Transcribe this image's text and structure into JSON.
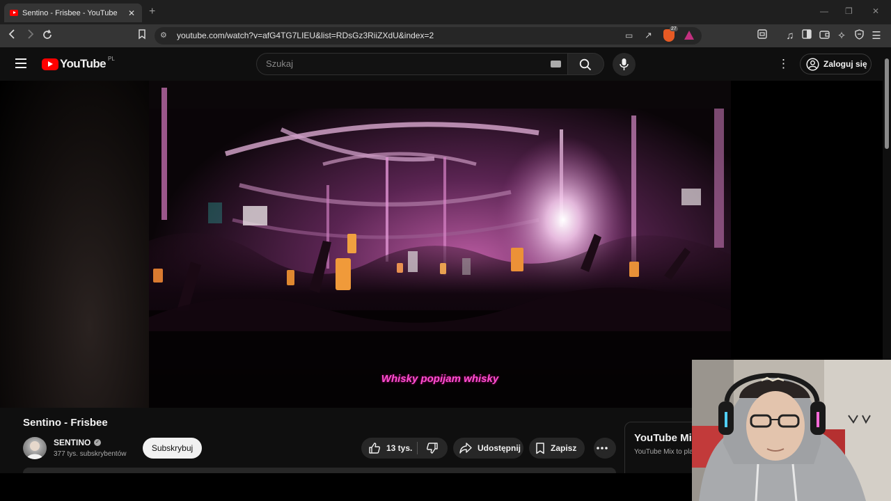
{
  "browser": {
    "tab_title": "Sentino - Frisbee - YouTube",
    "new_tab": "+",
    "url": "youtube.com/watch?v=afG4TG7LIEU&list=RDsGz3RiiZXdU&index=2",
    "shield_count": "27"
  },
  "youtube": {
    "logo_text": "YouTube",
    "country_code": "PL",
    "search_placeholder": "Szukaj",
    "signin_label": "Zaloguj się"
  },
  "video": {
    "caption": "Whisky popijam whisky",
    "title": "Sentino - Frisbee"
  },
  "channel": {
    "name": "SENTINO",
    "subscribers": "377 tys. subskrybentów",
    "subscribe_label": "Subskrybuj"
  },
  "actions": {
    "likes": "13 tys.",
    "share_label": "Udostępnij",
    "save_label": "Zapisz"
  },
  "mix": {
    "title": "YouTube Mix",
    "subtitle": "YouTube Mix to pla"
  }
}
